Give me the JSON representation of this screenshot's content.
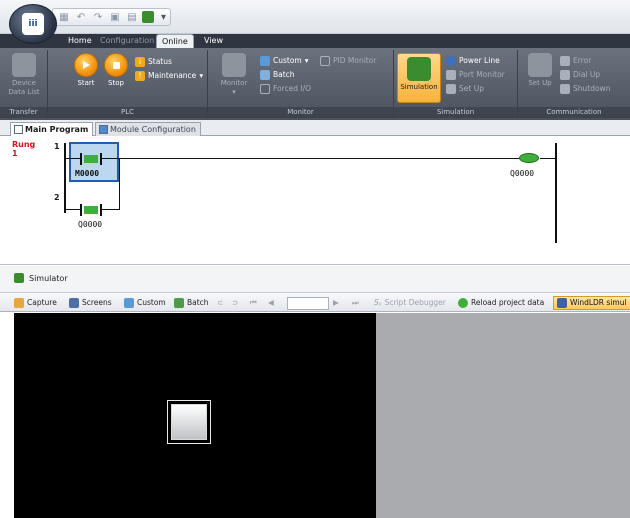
{
  "ribbon_tabs": {
    "home": "Home",
    "configuration": "Configuration",
    "online": "Online",
    "view": "View"
  },
  "ribbon": {
    "transfer": {
      "device_data_list": "Device\nData List",
      "label": "Transfer"
    },
    "plc": {
      "start": "Start",
      "stop": "Stop",
      "status": "Status",
      "maintenance": "Maintenance",
      "label": "PLC"
    },
    "monitor": {
      "monitor": "Monitor",
      "custom": "Custom",
      "pid_monitor": "PID Monitor",
      "batch": "Batch",
      "forced_io": "Forced I/O",
      "label": "Monitor"
    },
    "simulation": {
      "simulation": "Simulation",
      "power_line": "Power Line",
      "port_monitor": "Port Monitor",
      "set_up": "Set Up",
      "label": "Simulation"
    },
    "communication": {
      "set_up": "Set Up",
      "error": "Error",
      "dial_up": "Dial Up",
      "shutdown": "Shutdown",
      "label": "Communication"
    }
  },
  "program_tabs": {
    "main_program": "Main Program",
    "module_configuration": "Module Configuration"
  },
  "ladder": {
    "rung_label": "Rung",
    "rung_label_no": "1",
    "rung1_no": "1",
    "rung2_no": "2",
    "contact1": "M0000",
    "contact2": "Q0000",
    "coil1": "Q0000"
  },
  "simulator": {
    "title": "Simulator",
    "toolbar": {
      "capture": "Capture",
      "screens": "Screens",
      "custom": "Custom",
      "batch": "Batch",
      "script_debugger": "Script Debugger",
      "reload_project_data": "Reload project data",
      "windldr_sim": "WindLDR simul"
    }
  },
  "colors": {
    "ribbon_bg": "#5b626d",
    "contact_green": "#3fae3a",
    "rung_red": "#d4141a",
    "selection_blue": "#1f5fb2",
    "canvas_bg": "#000000"
  }
}
